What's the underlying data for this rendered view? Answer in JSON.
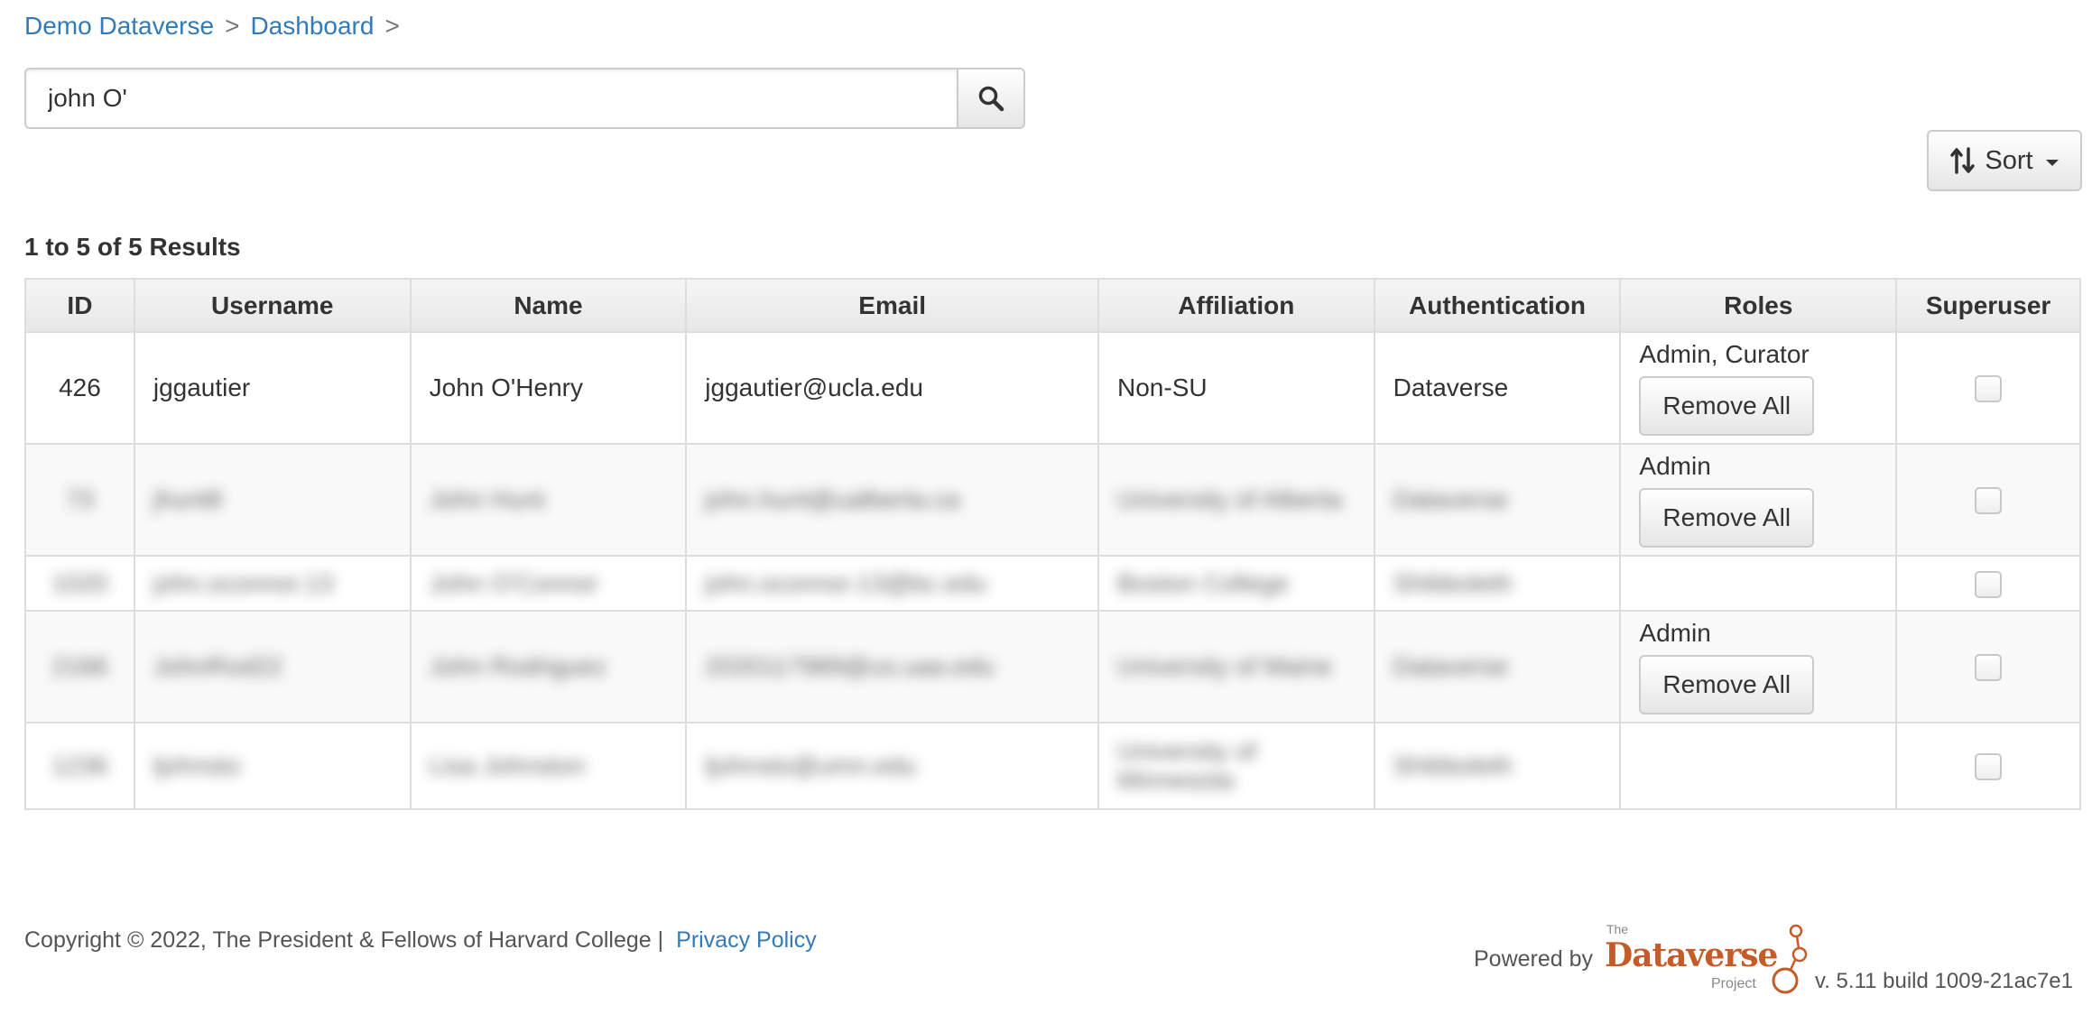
{
  "breadcrumb": {
    "items": [
      "Demo Dataverse",
      "Dashboard"
    ],
    "sep": ">"
  },
  "search": {
    "value": "john O'",
    "placeholder": ""
  },
  "sort": {
    "label": "Sort"
  },
  "results": {
    "count_text": "1 to 5 of 5 Results"
  },
  "table": {
    "headers": [
      "ID",
      "Username",
      "Name",
      "Email",
      "Affiliation",
      "Authentication",
      "Roles",
      "Superuser"
    ],
    "rows": [
      {
        "id": "426",
        "username": "jggautier",
        "name": "John O'Henry",
        "email": "jggautier@ucla.edu",
        "affiliation": "Non-SU",
        "authentication": "Dataverse",
        "roles": "Admin, Curator",
        "remove": "Remove All"
      },
      {
        "id": "73",
        "username": "jhunt8",
        "name": "John Hunt",
        "email": "john.hunt@ualberta.ca",
        "affiliation": "University of Alberta",
        "authentication": "Dataverse",
        "roles": "Admin",
        "remove": "Remove All"
      },
      {
        "id": "1020",
        "username": "john.oconnor.13",
        "name": "John O'Connor",
        "email": "john.oconnor.13@bc.edu",
        "affiliation": "Boston College",
        "authentication": "Shibboleth",
        "roles": "",
        "remove": ""
      },
      {
        "id": "2166",
        "username": "JohnRod22",
        "name": "John Rodriguez",
        "email": "2020117989@us.uaa.edu",
        "affiliation": "University of Maine",
        "authentication": "Dataverse",
        "roles": "Admin",
        "remove": "Remove All"
      },
      {
        "id": "1236",
        "username": "ljohnsto",
        "name": "Lisa Johnston",
        "email": "ljohnsto@umn.edu",
        "affiliation": "University of Minnesota",
        "authentication": "Shibboleth",
        "roles": "",
        "remove": ""
      }
    ]
  },
  "footer": {
    "copyright": "Copyright © 2022, The President & Fellows of Harvard College |",
    "privacy": "Privacy Policy",
    "powered_by": "Powered by",
    "logo_the": "The",
    "logo_word": "Dataverse",
    "logo_project": "Project",
    "version": "v. 5.11 build 1009-21ac7e1"
  },
  "colors": {
    "link": "#337ab7",
    "logo": "#c55b28"
  }
}
